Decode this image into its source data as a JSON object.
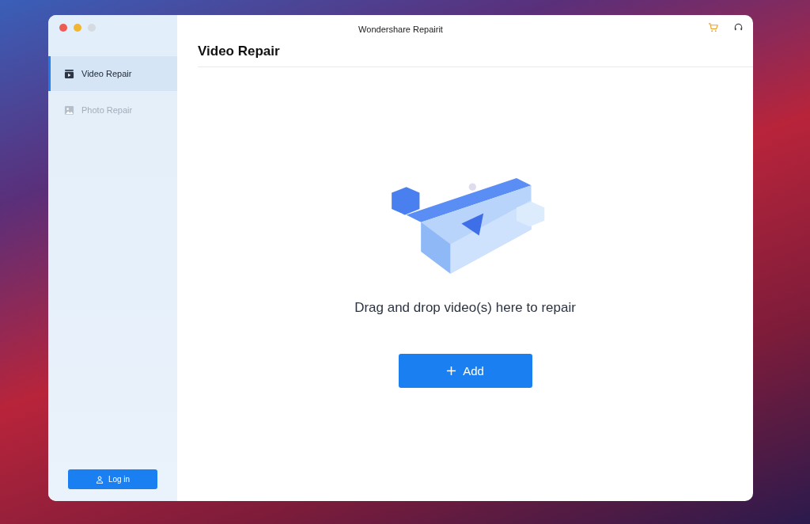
{
  "window": {
    "title": "Wondershare Repairit"
  },
  "sidebar": {
    "items": [
      {
        "label": "Video Repair",
        "kind": "video",
        "selected": true
      },
      {
        "label": "Photo Repair",
        "kind": "photo",
        "selected": false
      }
    ],
    "login_button": "Log in"
  },
  "main": {
    "heading": "Video Repair",
    "drop_hint": "Drag and drop video(s) here to repair",
    "add_button": "Add"
  }
}
